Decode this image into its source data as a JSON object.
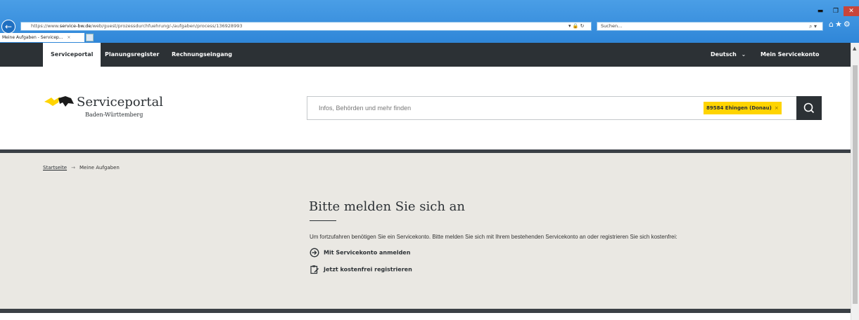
{
  "browser": {
    "url_prefix": "https://www.",
    "url_host": "service-bw.de",
    "url_path": "/web/guest/prozessdurchfuehrung/-/aufgaben/process/136928993",
    "search_placeholder": "Suchen...",
    "tab_title": "Meine Aufgaben - Servicep...",
    "tab_close": "×"
  },
  "topnav": {
    "items": [
      "Serviceportal",
      "Planungsregister",
      "Rechnungseingang"
    ],
    "language": "Deutsch",
    "account": "Mein Servicekonto"
  },
  "header": {
    "logo_title": "Serviceportal",
    "logo_subtitle": "Baden-Württemberg",
    "search_placeholder": "Infos, Behörden und mehr finden",
    "location_chip": "89584 Ehingen (Donau)",
    "location_clear": "×"
  },
  "breadcrumb": {
    "home": "Startseite",
    "arrow": "→",
    "current": "Meine Aufgaben"
  },
  "login": {
    "title": "Bitte melden Sie sich an",
    "text": "Um fortzufahren benötigen Sie ein Servicekonto. Bitte melden Sie sich mit Ihrem bestehenden Servicekonto an oder registrieren Sie sich kostenfrei:",
    "login_action": "Mit Servicekonto anmelden",
    "register_action": "Jetzt kostenfrei registrieren"
  },
  "colors": {
    "nav_bg": "#2c3135",
    "accent_yellow": "#ffd400",
    "content_bg": "#eae8e3",
    "browser_blue": "#2f86d8"
  }
}
